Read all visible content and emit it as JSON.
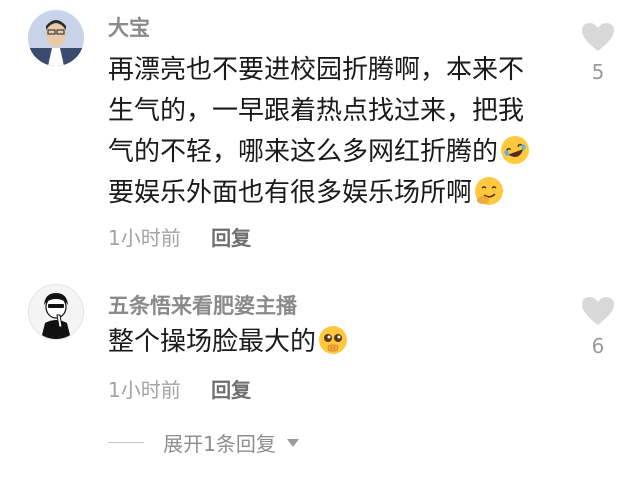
{
  "comments": [
    {
      "username": "大宝",
      "lines": [
        "再漂亮也不要进校园折腾啊，本来不",
        "生气的，一早跟着热点找过来，把我",
        "气的不轻，哪来这么多网红折腾的",
        "要娱乐外面也有很多娱乐场所啊"
      ],
      "emojis": [
        "rolling-laughing-emoji",
        "smirk-emoji"
      ],
      "time": "1小时前",
      "reply_label": "回复",
      "likes": "5"
    },
    {
      "username": "五条悟来看肥婆主播",
      "lines": [
        "整个操场脸最大的"
      ],
      "emojis": [
        "pleading-face-emoji"
      ],
      "time": "1小时前",
      "reply_label": "回复",
      "likes": "6"
    }
  ],
  "expand_replies_label": "展开1条回复",
  "colors": {
    "username": "#8a8a8a",
    "body": "#1a1a1a",
    "meta": "#a3a3a3",
    "heart": "#d8d8d8"
  }
}
